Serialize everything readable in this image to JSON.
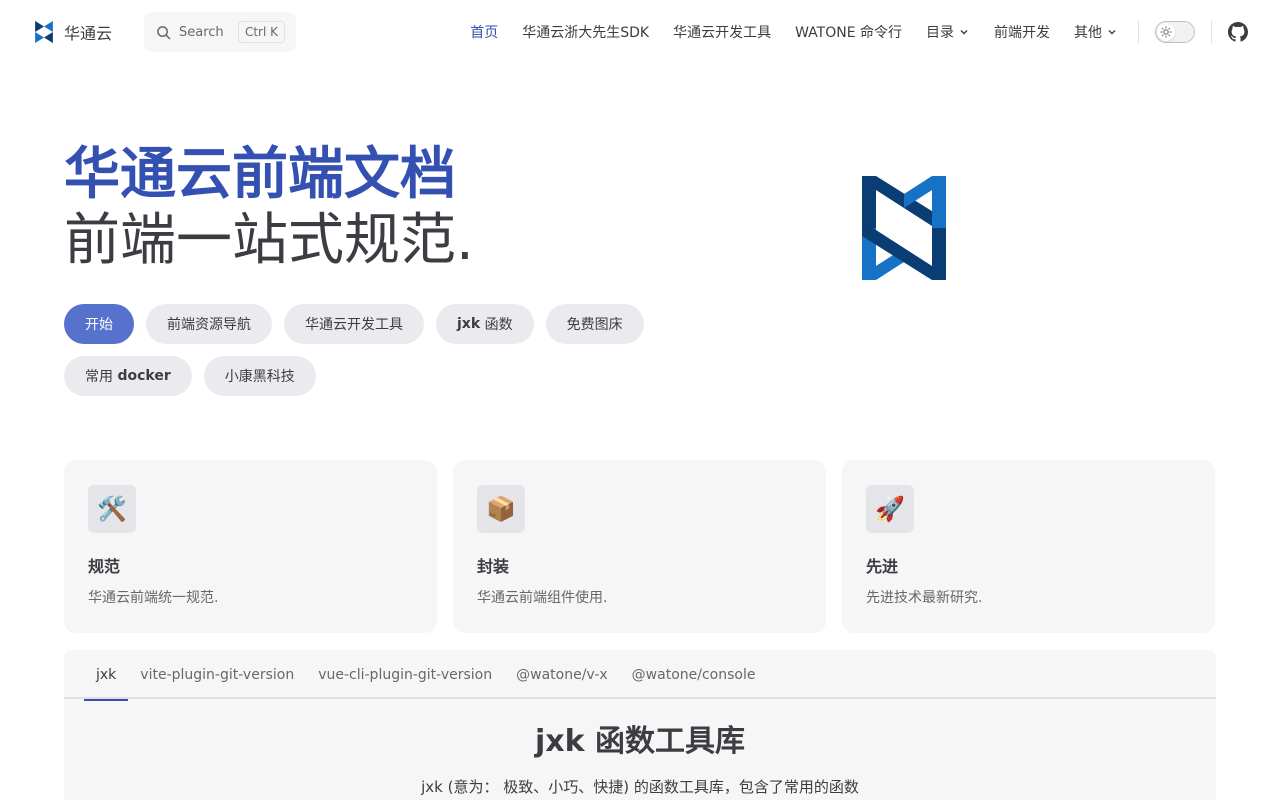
{
  "nav": {
    "title": "华通云",
    "search": {
      "label": "Search",
      "shortcut": "Ctrl K"
    },
    "menu": [
      {
        "label": "首页",
        "active": true
      },
      {
        "label": "华通云浙大先生SDK"
      },
      {
        "label": "华通云开发工具"
      },
      {
        "label": "WATONE 命令行"
      },
      {
        "label": "目录",
        "dropdown": true
      },
      {
        "label": "前端开发"
      },
      {
        "label": "其他",
        "dropdown": true
      }
    ],
    "icons": {
      "logo": "watone-logo-icon",
      "search": "search-icon",
      "theme": "sun-icon",
      "github": "github-icon"
    }
  },
  "hero": {
    "name": "华通云前端文档",
    "text": "前端一站式规范.",
    "actions": [
      {
        "label": "开始",
        "theme": "brand"
      },
      {
        "label": "前端资源导航"
      },
      {
        "label": "华通云开发工具"
      },
      {
        "label_bold": "jxk",
        "label": " 函数"
      },
      {
        "label": "免费图床"
      },
      {
        "label_prefix": "常用 ",
        "label_bold": "docker"
      },
      {
        "label": "小康黑科技"
      }
    ]
  },
  "features": [
    {
      "icon": "🛠️",
      "title": "规范",
      "details": "华通云前端统一规范."
    },
    {
      "icon": "📦",
      "title": "封装",
      "details": "华通云前端组件使用."
    },
    {
      "icon": "🚀",
      "title": "先进",
      "details": "先进技术最新研究."
    }
  ],
  "tabs": [
    {
      "label": "jxk",
      "active": true
    },
    {
      "label": "vite-plugin-git-version"
    },
    {
      "label": "vue-cli-plugin-git-version"
    },
    {
      "label": "@watone/v-x"
    },
    {
      "label": "@watone/console"
    }
  ],
  "doc": {
    "title_bold": "jxk",
    "title_rest": " 函数工具库",
    "description": "jxk (意为： 极致、小巧、快捷) 的函数工具库，包含了常用的函数"
  },
  "colors": {
    "brand": "#3451b2",
    "brand_button": "#5672cd",
    "text": "#3c3c43",
    "soft_bg": "#f6f6f7"
  }
}
